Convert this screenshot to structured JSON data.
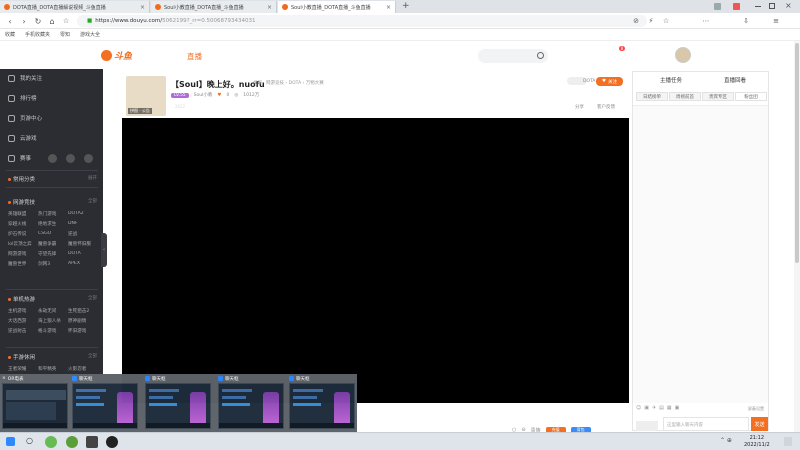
{
  "browser": {
    "tabs": [
      {
        "title": "DOTA直播_DOTA直播解说视频_斗鱼直播",
        "active": false
      },
      {
        "title": "Soul小教直播_DOTA直播_斗鱼直播",
        "active": false
      },
      {
        "title": "Soul小教直播_DOTA直播_斗鱼直播",
        "active": true
      }
    ],
    "new_tab": "+",
    "url_host": "https://www.douyu.com/",
    "url_path": "5062199?_rr=0.50068793434031",
    "bookmarks": [
      "收藏",
      "手机收藏夹",
      "零知",
      "游戏大全"
    ]
  },
  "site": {
    "logo_text": "斗鱼",
    "nav_live": "直播",
    "notif_count": "8"
  },
  "sidebar": {
    "items": [
      "我的关注",
      "排行榜",
      "页游中心",
      "云游戏",
      "赛事"
    ],
    "sections": [
      {
        "title": "常用分类",
        "more": "展开"
      },
      {
        "title": "网游竞技",
        "more": "全部",
        "games": [
          "英雄联盟",
          "热门游戏",
          "DOTA2",
          "穿越火线",
          "绝地求生",
          "DNF",
          "炉石传说",
          "CSGO",
          "逆战",
          "lol云顶之弈",
          "魔兽争霸",
          "魔兽怀旧服",
          "网游游戏",
          "守望先锋",
          "DOTA",
          "魔兽世界",
          "剑网3",
          "APEX"
        ]
      },
      {
        "title": "单机热游",
        "more": "全部",
        "games": [
          "主机游戏",
          "永劫无间",
          "生死狙击2",
          "大话西游",
          "海上狼人杀",
          "原神剧情",
          "逆战射击",
          "格斗游戏",
          "怀旧游戏"
        ]
      },
      {
        "title": "手游休闲",
        "more": "全部",
        "games": [
          "王者荣耀",
          "和平精英",
          "火影忍者"
        ]
      }
    ],
    "collapse": "‹"
  },
  "room": {
    "title": "【Soul】晚上好。nuofu",
    "report": "举报",
    "crumbs": "网游竞技 › DOTA › 万物大赛",
    "level": "LV.55",
    "streamer": "Soul小教",
    "likes": "0",
    "fans": "1012万",
    "avatar_label": "拼图 · 公告",
    "hot": "2022",
    "dota_tag": "DOTA",
    "follow": "关注",
    "share": "分享",
    "report_btn": "客户反馈"
  },
  "right_panel": {
    "tabs": [
      "主播任务",
      "直播回看"
    ],
    "subtabs": [
      "日结榜单",
      "周榜前首",
      "贵宾专区",
      "粉丝团"
    ],
    "chat_settings": "屏蔽设置",
    "chat_placeholder": "这里输入聊天内容",
    "send": "发送"
  },
  "giftbar": {
    "label": "贵族",
    "btn1": "充值",
    "btn2": "背包",
    "btn1_color": "#f36f21",
    "btn2_color": "#3a8cf6"
  },
  "thumbnails": [
    {
      "label": "OR电表"
    },
    {
      "label": "聊天框"
    },
    {
      "label": "聊天框"
    },
    {
      "label": "聊天框"
    },
    {
      "label": "聊天框"
    }
  ],
  "clock": {
    "time": "21:12",
    "date": "2022/11/2"
  },
  "colors": {
    "accent": "#f36f21",
    "sidebar_bg": "#2b2d32",
    "player_bg": "#000000"
  }
}
